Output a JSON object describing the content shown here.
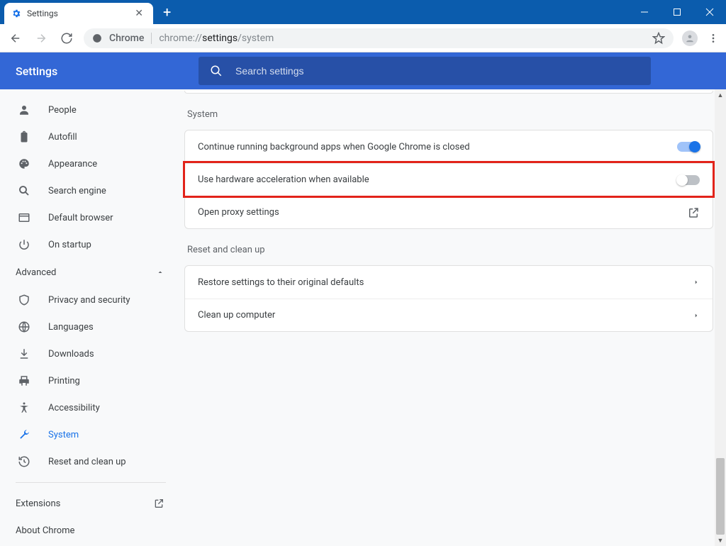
{
  "window": {
    "tab_title": "Settings"
  },
  "toolbar": {
    "secure_label": "Chrome",
    "url_prefix": "chrome://",
    "url_bold": "settings",
    "url_suffix": "/system"
  },
  "header": {
    "title": "Settings",
    "search_placeholder": "Search settings"
  },
  "sidebar": {
    "items": [
      {
        "label": "People"
      },
      {
        "label": "Autofill"
      },
      {
        "label": "Appearance"
      },
      {
        "label": "Search engine"
      },
      {
        "label": "Default browser"
      },
      {
        "label": "On startup"
      }
    ],
    "advanced_label": "Advanced",
    "advanced_items": [
      {
        "label": "Privacy and security"
      },
      {
        "label": "Languages"
      },
      {
        "label": "Downloads"
      },
      {
        "label": "Printing"
      },
      {
        "label": "Accessibility"
      },
      {
        "label": "System"
      },
      {
        "label": "Reset and clean up"
      }
    ],
    "extensions_label": "Extensions",
    "about_label": "About Chrome"
  },
  "main": {
    "system_title": "System",
    "system_rows": {
      "bg_apps": "Continue running background apps when Google Chrome is closed",
      "hw_accel": "Use hardware acceleration when available",
      "proxy": "Open proxy settings"
    },
    "reset_title": "Reset and clean up",
    "reset_rows": {
      "restore": "Restore settings to their original defaults",
      "cleanup": "Clean up computer"
    }
  }
}
